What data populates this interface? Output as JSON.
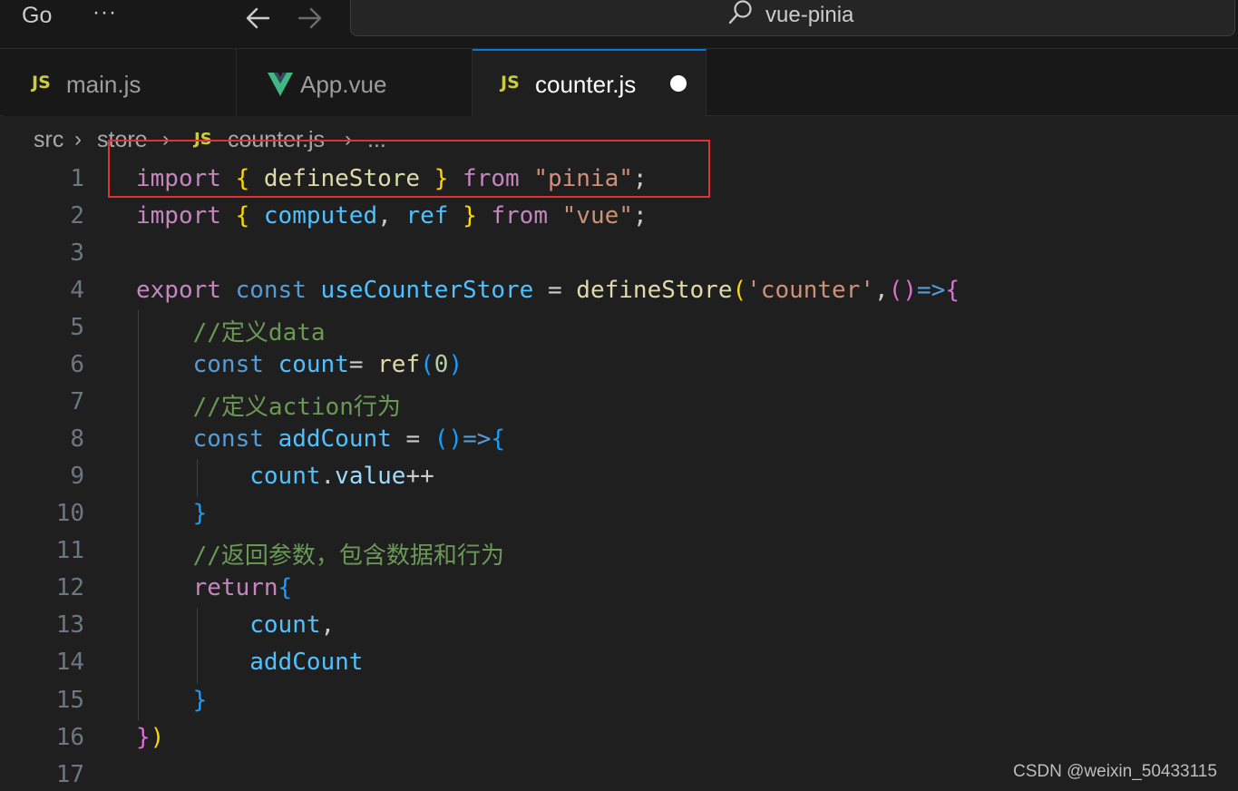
{
  "titlebar": {
    "menu_go": "Go",
    "menu_more": "···",
    "back_icon": "arrow-left-icon",
    "forward_icon": "arrow-right-icon",
    "search_icon": "search-icon",
    "search_text": "vue-pinia"
  },
  "tabs": [
    {
      "icon": "JS",
      "label": "main.js",
      "active": false
    },
    {
      "icon": "vue-logo-icon",
      "label": "App.vue",
      "active": false
    },
    {
      "icon": "JS",
      "label": "counter.js",
      "active": true,
      "modified": true
    }
  ],
  "breadcrumb": {
    "items": [
      "src",
      "store",
      "counter.js",
      "..."
    ],
    "file_icon": "JS"
  },
  "editor": {
    "line_numbers": [
      "1",
      "2",
      "3",
      "4",
      "5",
      "6",
      "7",
      "8",
      "9",
      "10",
      "11",
      "12",
      "13",
      "14",
      "15",
      "16",
      "17"
    ],
    "code_lines": [
      "import { defineStore } from \"pinia\";",
      "import { computed, ref } from \"vue\";",
      "",
      "export const useCounterStore = defineStore('counter',()=>{",
      "    //定义data",
      "    const count= ref(0)",
      "    //定义action行为",
      "    const addCount = ()=>{",
      "        count.value++",
      "    }",
      "    //返回参数，包含数据和行为",
      "    return{",
      "        count,",
      "        addCount",
      "    }",
      "})",
      ""
    ]
  },
  "watermark": "CSDN @weixin_50433115",
  "colors": {
    "background": "#1f1f1f",
    "keyword": "#c586c0",
    "storage": "#569cd6",
    "function": "#dcdcaa",
    "variable": "#9cdcfe",
    "string": "#ce9178",
    "comment": "#6a9955",
    "highlight_box": "#e03232",
    "active_tab_border": "#0078d4"
  }
}
